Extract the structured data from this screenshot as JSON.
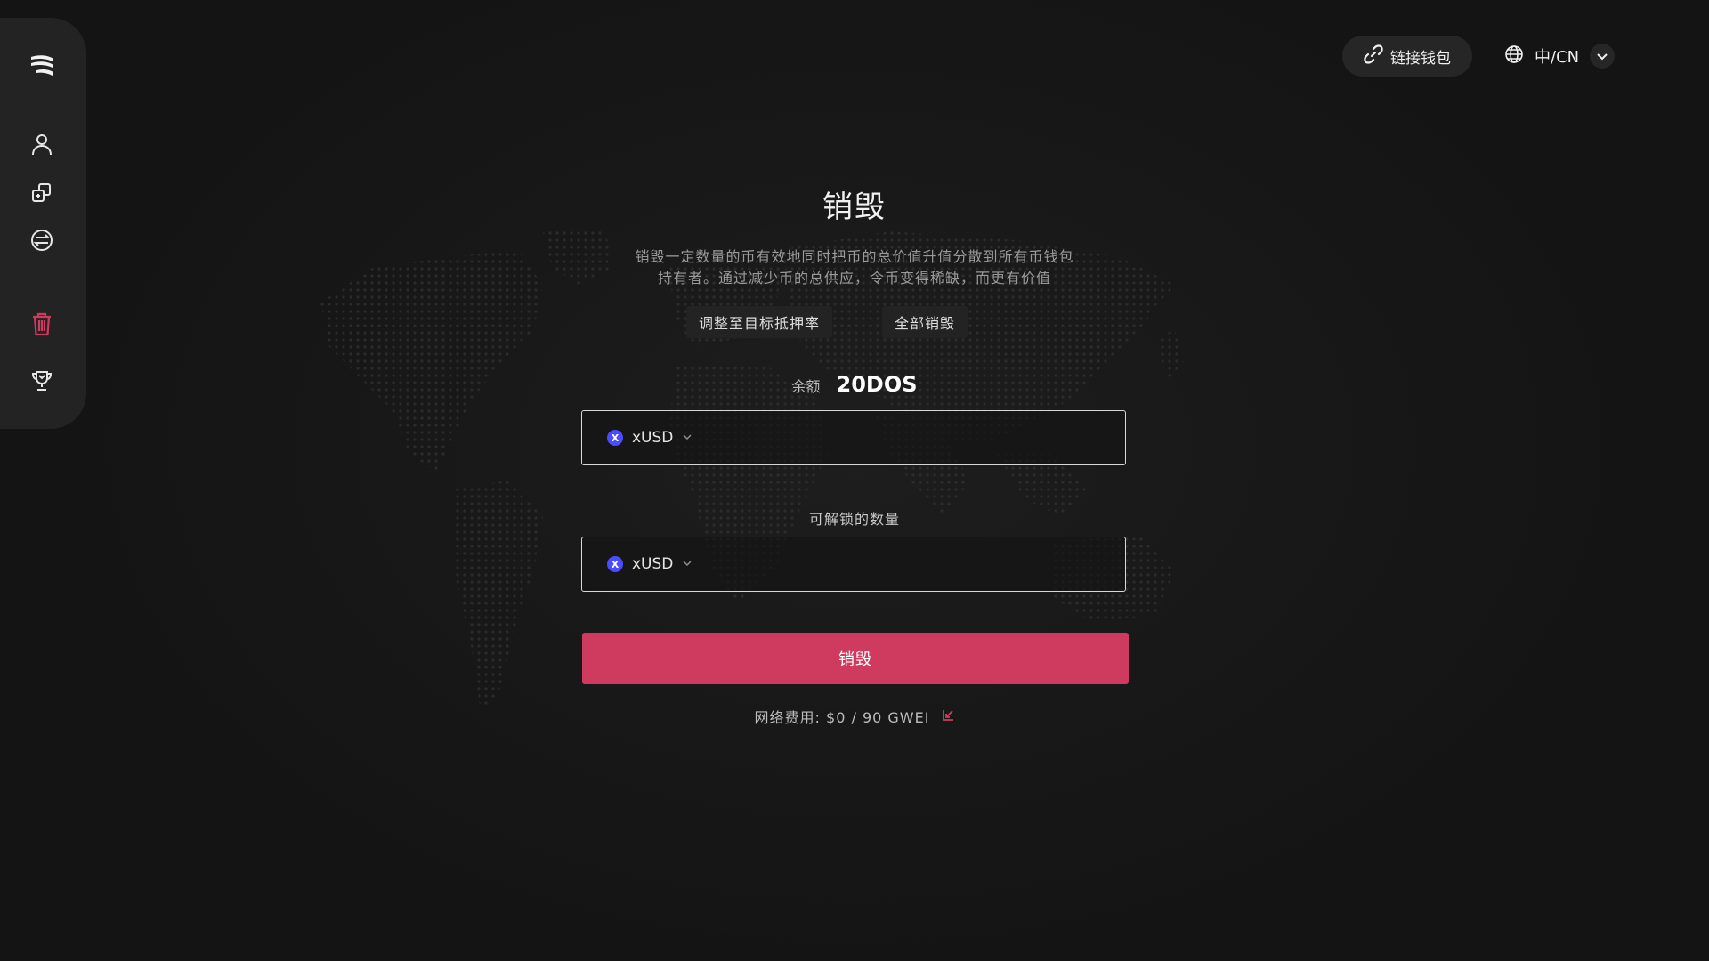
{
  "header": {
    "wallet_label": "链接钱包",
    "language_label": "中/CN"
  },
  "sidebar": {
    "items": [
      {
        "icon": "logo-icon"
      },
      {
        "icon": "user-icon"
      },
      {
        "icon": "stack-icon"
      },
      {
        "icon": "exchange-icon"
      },
      {
        "icon": "trash-icon",
        "active": true
      },
      {
        "icon": "trophy-icon"
      }
    ],
    "accent": "#cf3b5f"
  },
  "main": {
    "title": "销毁",
    "description_line1": "销毁一定数量的币有效地同时把币的总价值升值分散到所有币钱包",
    "description_line2": "持有者。通过减少币的总供应，令币变得稀缺，而更有价值",
    "adjust_label": "调整至目标抵押率",
    "burn_all_label": "全部销毁",
    "balance_label": "余额",
    "balance_value": "20DOS",
    "input1": {
      "token": "xUSD",
      "token_icon_letter": "X",
      "value": ""
    },
    "unlock_label": "可解锁的数量",
    "input2": {
      "token": "xUSD",
      "token_icon_letter": "X",
      "value": ""
    },
    "burn_button": "销毁",
    "fee_text": "网络费用: $0 / 90 GWEI"
  },
  "colors": {
    "background": "#161616",
    "accent": "#cf3b5f",
    "token_icon": "#4b4cff"
  }
}
